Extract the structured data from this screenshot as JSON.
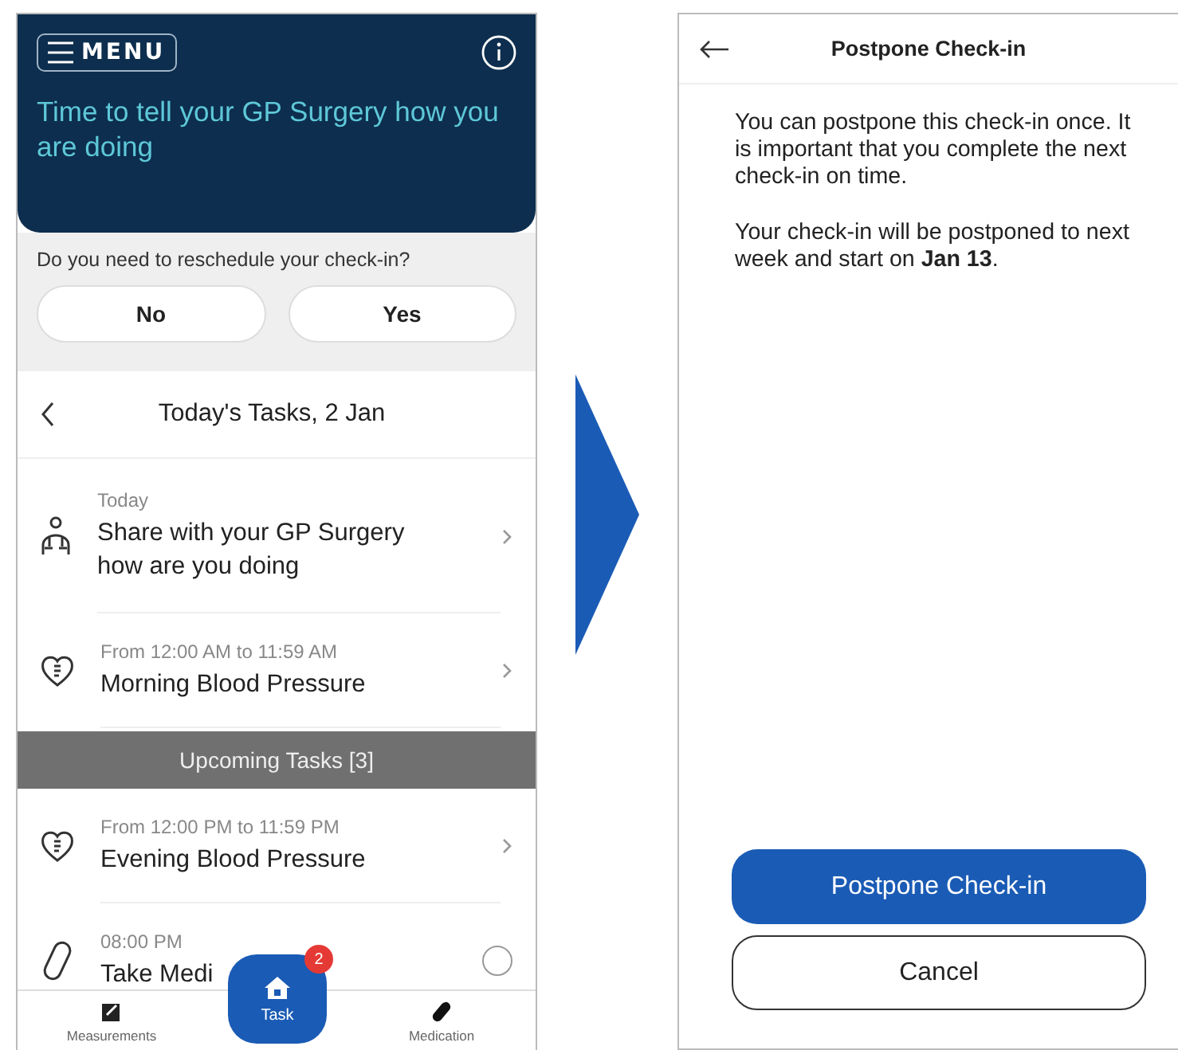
{
  "left_screen": {
    "menu_button": "MENU",
    "headline": "Time to tell your GP Surgery how you are doing",
    "reschedule": {
      "question": "Do you need to reschedule your check-in?",
      "buttons": [
        "No",
        "Yes"
      ]
    },
    "tasks_title": "Today's Tasks, 2 Jan",
    "today_tasks": [
      {
        "kind": "survey",
        "time": "Today",
        "name": "Share with your GP Surgery how are you doing",
        "done": false
      },
      {
        "kind": "heart",
        "time": "From 12:00 AM to 11:59 AM",
        "name": "Morning Blood Pressure",
        "done": false
      }
    ],
    "upcoming_header": "Upcoming Tasks [3]",
    "upcoming_tasks": [
      {
        "kind": "heart",
        "time": "From 12:00 PM to 11:59 PM",
        "name": "Evening Blood Pressure",
        "done": false
      },
      {
        "kind": "pill",
        "time": "08:00 PM",
        "name": "Take Medi",
        "done": false
      }
    ],
    "nav": [
      {
        "kind": "measure",
        "label": "Measurements"
      },
      {
        "kind": "home",
        "label": "Task",
        "badge": "2"
      },
      {
        "kind": "pill",
        "label": "Medication"
      }
    ]
  },
  "right_screen": {
    "title": "Postpone Check-in",
    "paragraphs": [
      "You can postpone this check-in once. It is important that you complete the next check-in on time.",
      "Your check-in will be postponed to next week and start on **Jan 13**."
    ],
    "buttons": [
      {
        "kind": "primary",
        "label": "Postpone Check-in"
      },
      {
        "kind": "secondary",
        "label": "Cancel"
      }
    ]
  }
}
